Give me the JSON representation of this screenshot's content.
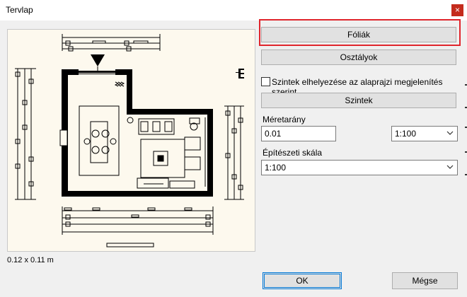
{
  "window": {
    "title": "Tervlap",
    "close_icon": "close-icon"
  },
  "preview": {
    "dimensions": "0.12 x 0.11 m"
  },
  "buttons": {
    "foliak": "Fóliák",
    "osztalyok": "Osztályok",
    "szintek": "Szintek",
    "ok": "OK",
    "megse": "Mégse"
  },
  "levels_checkbox": {
    "label": "Szintek elhelyezése az alaprajzi megjelenítés szerint",
    "checked": false
  },
  "scale": {
    "label": "Méretarány",
    "value": "0.01",
    "select_value": "1:100"
  },
  "architectural_scale": {
    "label": "Építészeti skála",
    "select_value": "1:100"
  },
  "colors": {
    "highlight": "#e0252c",
    "preview_bg": "#fdf9ee",
    "dialog_bg": "#f0f0f0",
    "close_bg": "#c42b1c"
  }
}
